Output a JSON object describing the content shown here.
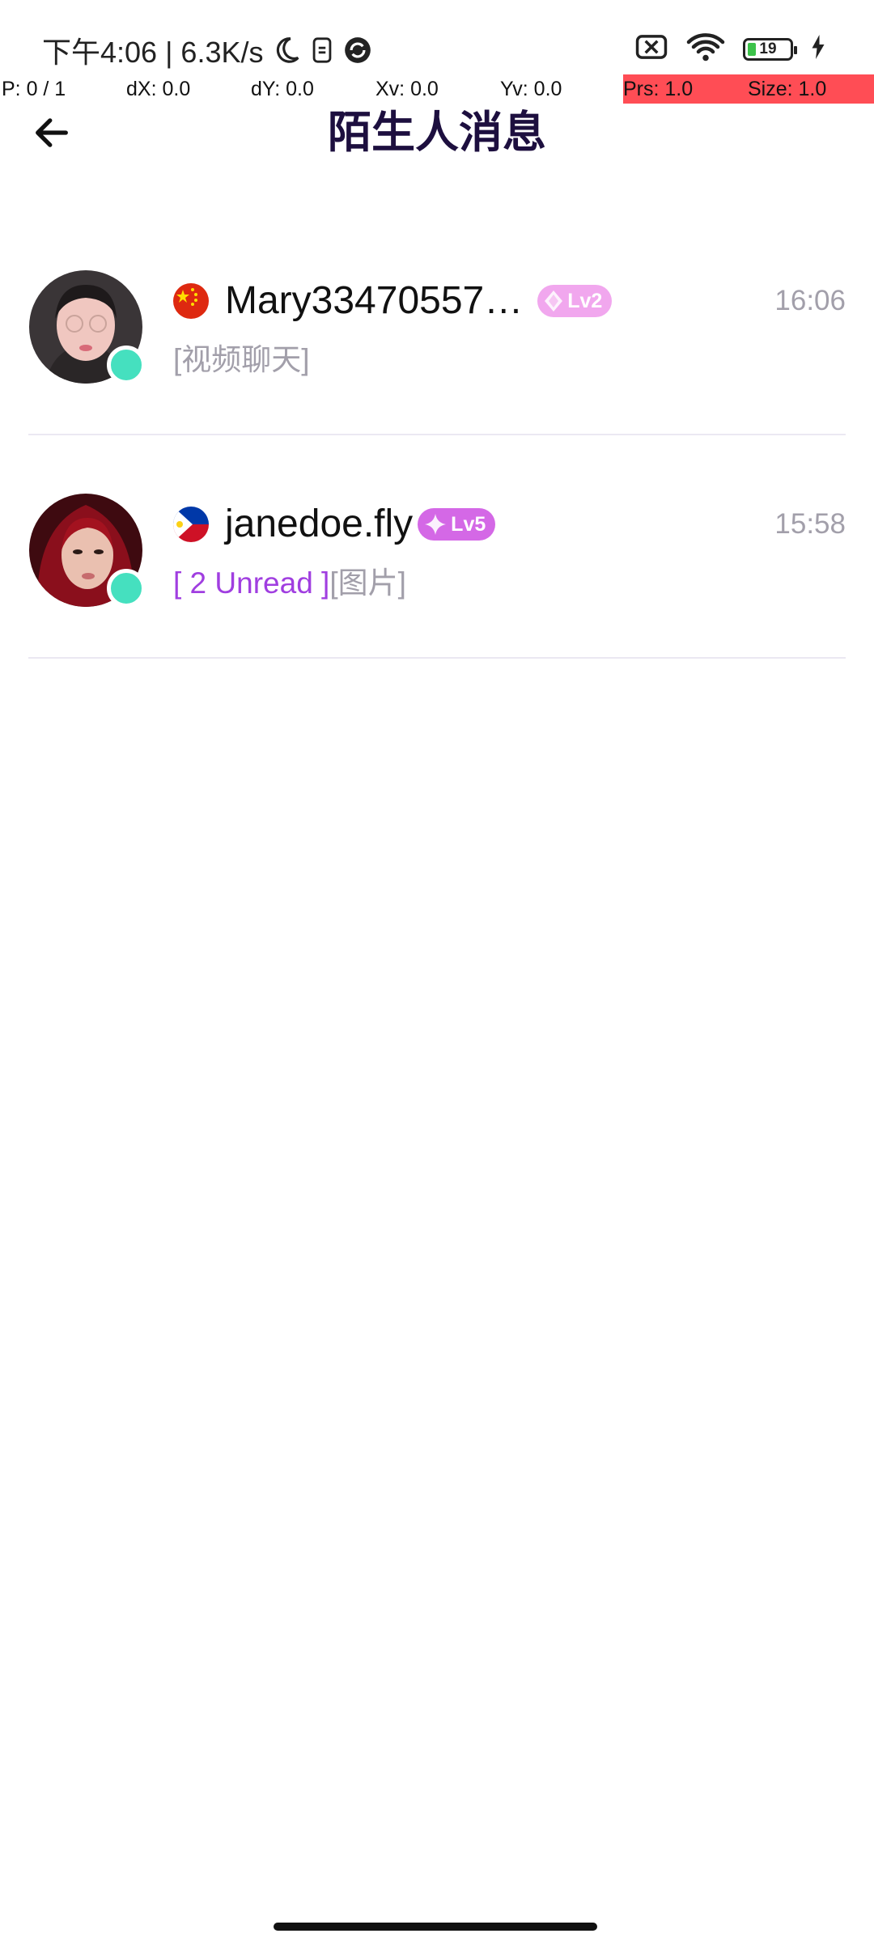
{
  "status_bar": {
    "time_speed": "下午4:06 | 6.3K/s",
    "icons": [
      "moon-icon",
      "sim-icon",
      "vpn-icon",
      "no-signal-icon",
      "wifi-icon",
      "battery-icon",
      "charging-icon"
    ],
    "battery_level": "19",
    "battery_fraction": 0.19
  },
  "pointer_overlay": {
    "p": "P: 0 / 1",
    "dx": "dX: 0.0",
    "dy": "dY: 0.0",
    "xv": "Xv: 0.0",
    "yv": "Yv: 0.0",
    "prs": "Prs: 1.0",
    "size": "Size: 1.0",
    "highlight_color": "#ff4d55"
  },
  "header": {
    "back_icon": "arrow-left-icon",
    "title": "陌生人消息"
  },
  "conversations": [
    {
      "name": "Mary33470557…",
      "flag": "china-flag",
      "level": "Lv2",
      "level_color": "#f1a7ee",
      "time": "16:06",
      "unread": "",
      "preview": "[视频聊天]",
      "online": true
    },
    {
      "name": "janedoe.fly",
      "flag": "philippines-flag",
      "level": "Lv5",
      "level_color": "#d468e6",
      "time": "15:58",
      "unread": "[ 2 Unread ]",
      "preview": "[图片]",
      "online": true
    }
  ],
  "colors": {
    "title": "#1d0f3f",
    "secondary_text": "#a29faa",
    "unread": "#a03ee0",
    "online": "#45e0bf"
  }
}
